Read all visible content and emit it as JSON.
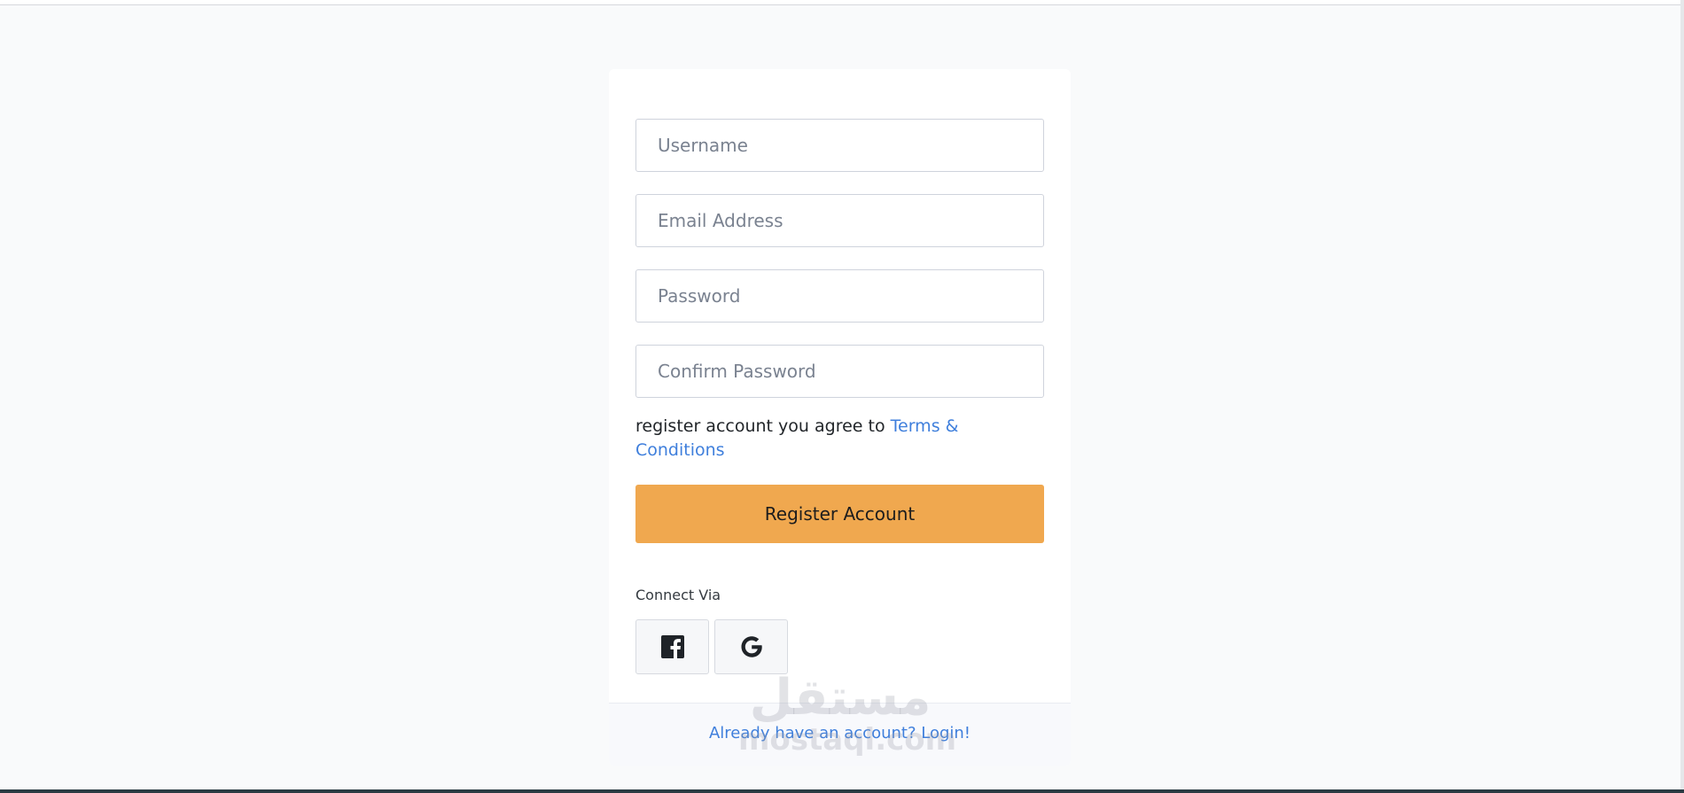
{
  "form": {
    "username_placeholder": "Username",
    "email_placeholder": "Email Address",
    "password_placeholder": "Password",
    "confirm_placeholder": "Confirm Password",
    "terms_text": "register account you agree to ",
    "terms_link": "Terms & Conditions",
    "register_label": "Register Account",
    "connect_label": "Connect Via",
    "social": [
      {
        "icon": "facebook-icon"
      },
      {
        "icon": "google-icon"
      }
    ]
  },
  "footer": {
    "login_link": "Already have an account? Login!"
  },
  "watermark": {
    "arabic": "مستقل",
    "latin": "mostaql.com"
  },
  "colors": {
    "accent": "#f0a84f",
    "link": "#3f7fdc",
    "background": "#f9fafb"
  }
}
